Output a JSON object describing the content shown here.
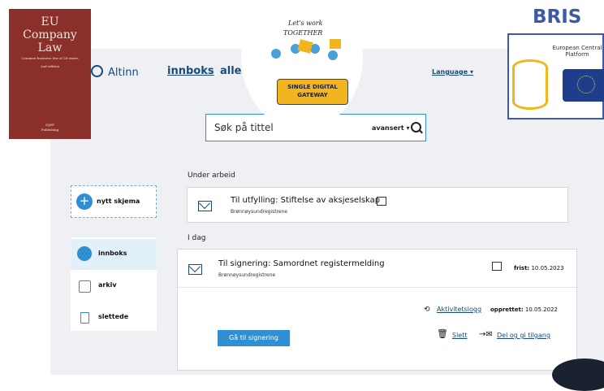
{
  "header": {
    "logo": "Altinn",
    "nav_inbox": "innboks",
    "nav_all": "alle s",
    "language": "Language ▾"
  },
  "search": {
    "placeholder": "Søk på tittel",
    "advanced": "avansert ▾"
  },
  "new_form": {
    "label": "nytt skjema"
  },
  "sidebar": {
    "items": [
      {
        "label": "innboks",
        "icon": "inbox-icon"
      },
      {
        "label": "arkiv",
        "icon": "archive-icon"
      },
      {
        "label": "slettede",
        "icon": "trash-icon"
      }
    ]
  },
  "sections": {
    "under_work": "Under arbeid",
    "today": "I dag"
  },
  "draft_card": {
    "title": "Til utfylling: Stiftelse av aksjeselskap",
    "sender": "Brønnøysundregistrene"
  },
  "sign_card": {
    "title": "Til signering: Samordnet registermelding",
    "sender": "Brønnøysundregistrene",
    "deadline_label": "frist:",
    "deadline": "10.05.2023",
    "activity_log": "Aktivitetslogg",
    "created_label": "opprettet:",
    "created": "10.05.2022",
    "sign_button": "Gå til signering",
    "delete": "Slett",
    "share": "Del og gi tilgang"
  },
  "overlays": {
    "book": {
      "title1": "EU",
      "title2": "Company",
      "title3": "Law",
      "subtitle": "Common business law of 28 states",
      "edition": "2nd edition",
      "publisher1": "DJØF",
      "publisher2": "Publishing"
    },
    "sdg": {
      "lets": "Let's work",
      "together": "TOGETHER",
      "banner1": "SINGLE DIGITAL",
      "banner2": "GATEWAY"
    },
    "bris": {
      "title": "BRIS",
      "platform": "European Central Platform"
    }
  },
  "colors": {
    "accent": "#2f8fd1",
    "brand_dark": "#1a4a7a",
    "background": "#eef0f3",
    "book": "#8a2f2a",
    "bris_blue": "#3c5aa8",
    "sdg_banner": "#f3b51f"
  }
}
